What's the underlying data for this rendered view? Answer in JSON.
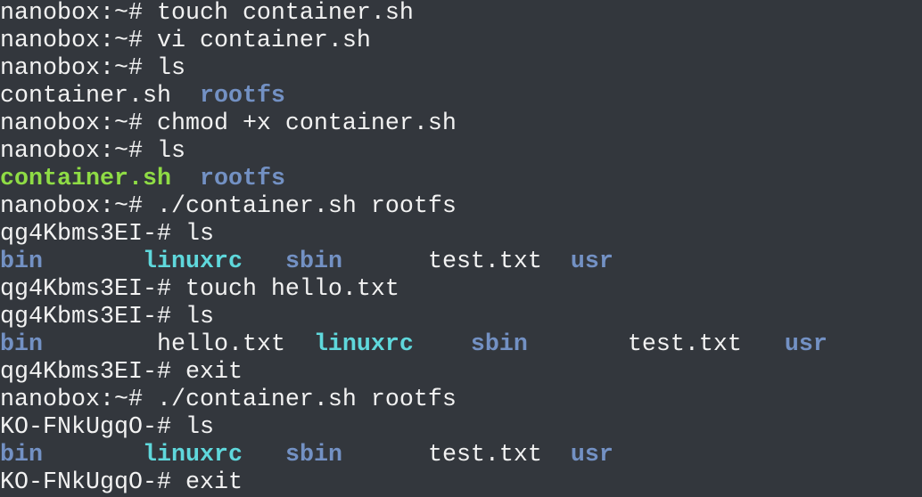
{
  "colors": {
    "background": "#33373d",
    "text": "#f2f2f2",
    "directory": "#7391c4",
    "executable": "#8fdc45",
    "symlink": "#5fd8dc"
  },
  "lines": [
    [
      {
        "t": "nanobox:~# touch container.sh",
        "k": "plain"
      }
    ],
    [
      {
        "t": "nanobox:~# vi container.sh",
        "k": "plain"
      }
    ],
    [
      {
        "t": "nanobox:~# ls",
        "k": "plain"
      }
    ],
    [
      {
        "t": "container.sh  ",
        "k": "plain"
      },
      {
        "t": "rootfs",
        "k": "dir"
      }
    ],
    [
      {
        "t": "nanobox:~# chmod +x container.sh",
        "k": "plain"
      }
    ],
    [
      {
        "t": "nanobox:~# ls",
        "k": "plain"
      }
    ],
    [
      {
        "t": "container.sh",
        "k": "exec"
      },
      {
        "t": "  ",
        "k": "plain"
      },
      {
        "t": "rootfs",
        "k": "dir"
      }
    ],
    [
      {
        "t": "nanobox:~# ./container.sh rootfs",
        "k": "plain"
      }
    ],
    [
      {
        "t": "qg4Kbms3EI-# ls",
        "k": "plain"
      }
    ],
    [
      {
        "t": "bin",
        "k": "dir"
      },
      {
        "t": "       ",
        "k": "plain"
      },
      {
        "t": "linuxrc",
        "k": "link"
      },
      {
        "t": "   ",
        "k": "plain"
      },
      {
        "t": "sbin",
        "k": "dir"
      },
      {
        "t": "      test.txt  ",
        "k": "plain"
      },
      {
        "t": "usr",
        "k": "dir"
      }
    ],
    [
      {
        "t": "qg4Kbms3EI-# touch hello.txt",
        "k": "plain"
      }
    ],
    [
      {
        "t": "qg4Kbms3EI-# ls",
        "k": "plain"
      }
    ],
    [
      {
        "t": "bin",
        "k": "dir"
      },
      {
        "t": "        hello.txt  ",
        "k": "plain"
      },
      {
        "t": "linuxrc",
        "k": "link"
      },
      {
        "t": "    ",
        "k": "plain"
      },
      {
        "t": "sbin",
        "k": "dir"
      },
      {
        "t": "       test.txt   ",
        "k": "plain"
      },
      {
        "t": "usr",
        "k": "dir"
      }
    ],
    [
      {
        "t": "qg4Kbms3EI-# exit",
        "k": "plain"
      }
    ],
    [
      {
        "t": "nanobox:~# ./container.sh rootfs",
        "k": "plain"
      }
    ],
    [
      {
        "t": "KO-FNkUgqO-# ls",
        "k": "plain"
      }
    ],
    [
      {
        "t": "bin",
        "k": "dir"
      },
      {
        "t": "       ",
        "k": "plain"
      },
      {
        "t": "linuxrc",
        "k": "link"
      },
      {
        "t": "   ",
        "k": "plain"
      },
      {
        "t": "sbin",
        "k": "dir"
      },
      {
        "t": "      test.txt  ",
        "k": "plain"
      },
      {
        "t": "usr",
        "k": "dir"
      }
    ],
    [
      {
        "t": "KO-FNkUgqO-# exit",
        "k": "plain"
      }
    ]
  ]
}
